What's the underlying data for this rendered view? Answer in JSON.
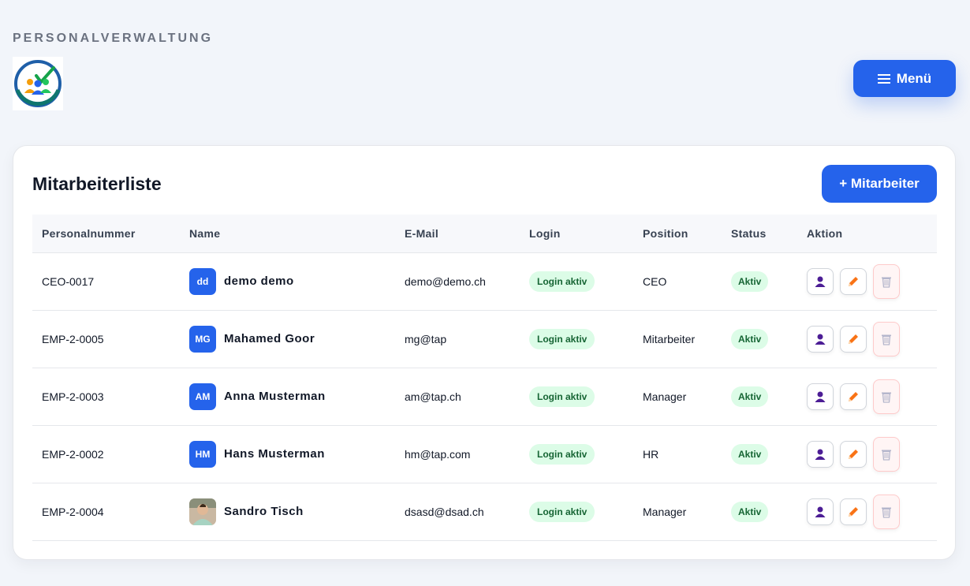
{
  "header": {
    "app_title": "PERSONALVERWALTUNG",
    "menu_label": "Menü"
  },
  "card": {
    "title": "Mitarbeiterliste",
    "add_label": "+ Mitarbeiter"
  },
  "table": {
    "columns": [
      "Personalnummer",
      "Name",
      "E-Mail",
      "Login",
      "Position",
      "Status",
      "Aktion"
    ],
    "rows": [
      {
        "id": "CEO-0017",
        "initials": "dd",
        "name": "demo demo",
        "email": "demo@demo.ch",
        "login": "Login aktiv",
        "position": "CEO",
        "status": "Aktiv"
      },
      {
        "id": "EMP-2-0005",
        "initials": "MG",
        "name": "Mahamed Goor",
        "email": "mg@tap",
        "login": "Login aktiv",
        "position": "Mitarbeiter",
        "status": "Aktiv"
      },
      {
        "id": "EMP-2-0003",
        "initials": "AM",
        "name": "Anna Musterman",
        "email": "am@tap.ch",
        "login": "Login aktiv",
        "position": "Manager",
        "status": "Aktiv"
      },
      {
        "id": "EMP-2-0002",
        "initials": "HM",
        "name": "Hans Musterman",
        "email": "hm@tap.com",
        "login": "Login aktiv",
        "position": "HR",
        "status": "Aktiv"
      },
      {
        "id": "EMP-2-0004",
        "initials": "",
        "name": "Sandro Tisch",
        "email": "dsasd@dsad.ch",
        "login": "Login aktiv",
        "position": "Manager",
        "status": "Aktiv"
      }
    ]
  },
  "icons": {
    "logo": "clock-team-logo",
    "menu": "hamburger-icon",
    "view": "user-icon",
    "edit": "pencil-icon",
    "delete": "trash-icon"
  },
  "colors": {
    "primary": "#2563eb",
    "success_bg": "#dcfce7",
    "success_text": "#166534",
    "page_bg": "#f2f5fa"
  }
}
